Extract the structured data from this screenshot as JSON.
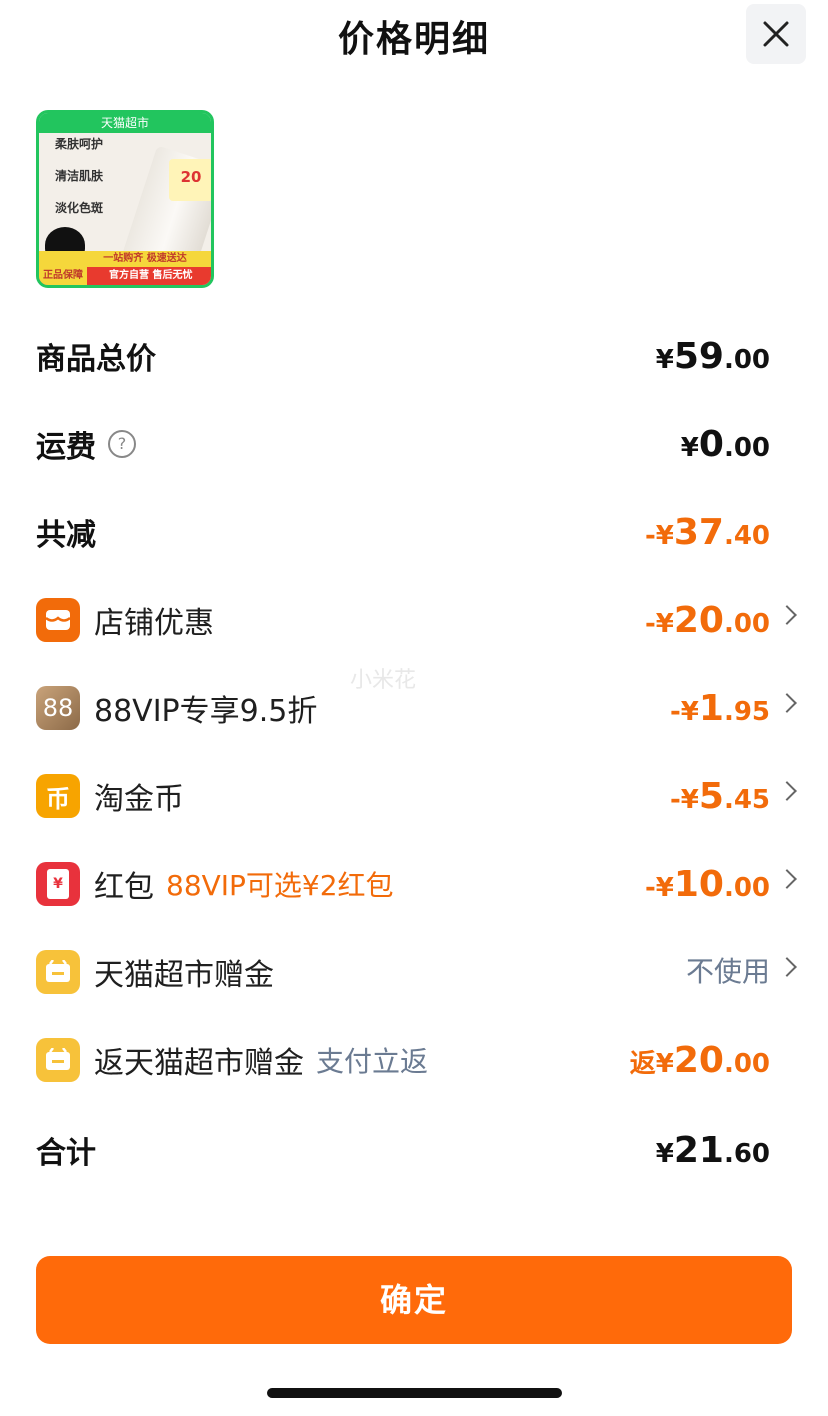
{
  "header": {
    "title": "价格明细"
  },
  "product": {
    "banner_top": "天猫超市",
    "lines": [
      "柔肤呵护",
      "清洁肌肤",
      "淡化色斑"
    ],
    "coupon_value": "20",
    "bottom_line1": "一站购齐 极速送达",
    "bottom_badge": "正品保障",
    "bottom_line2": "官方自营 售后无忧"
  },
  "rows": {
    "total_goods": {
      "label": "商品总价",
      "cur": "¥",
      "int": "59",
      "dec": ".00"
    },
    "shipping": {
      "label": "运费",
      "help": "?",
      "cur": "¥",
      "int": "0",
      "dec": ".00"
    },
    "total_discount": {
      "label": "共减",
      "cur": "-¥",
      "int": "37",
      "dec": ".40"
    },
    "store_discount": {
      "label": "店铺优惠",
      "cur": "-¥",
      "int": "20",
      "dec": ".00"
    },
    "vip": {
      "icon_text": "88",
      "label": "88VIP专享9.5折",
      "cur": "-¥",
      "int": "1",
      "dec": ".95"
    },
    "coins": {
      "icon_text": "币",
      "label": "淘金币",
      "cur": "-¥",
      "int": "5",
      "dec": ".45"
    },
    "redpack": {
      "icon_text": "¥",
      "label": "红包",
      "sub": "88VIP可选¥2红包",
      "cur": "-¥",
      "int": "10",
      "dec": ".00"
    },
    "gift_card": {
      "label": "天猫超市赠金",
      "value": "不使用"
    },
    "rebate": {
      "label": "返天猫超市赠金",
      "sub": "支付立返",
      "cur": "返¥",
      "int": "20",
      "dec": ".00"
    },
    "grand_total": {
      "label": "合计",
      "cur": "¥",
      "int": "21",
      "dec": ".60"
    }
  },
  "watermark": "小米花",
  "confirm_label": "确定",
  "colors": {
    "accent": "#ff6a0a",
    "discount": "#f26b0a",
    "muted": "#6b7b92"
  }
}
